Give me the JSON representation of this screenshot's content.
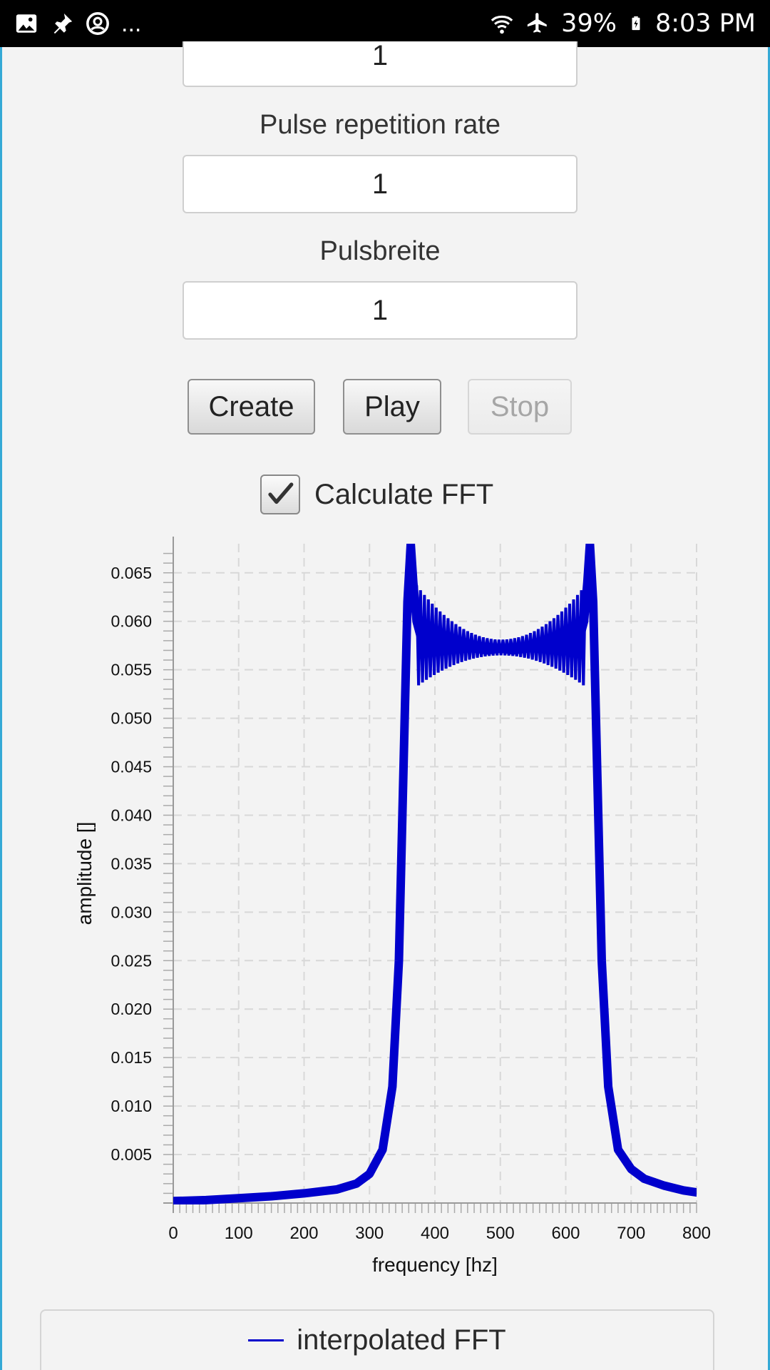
{
  "status_bar": {
    "icons_left": [
      "image-icon",
      "pin-icon",
      "account-circle-icon"
    ],
    "more": "...",
    "icons_right": [
      "wifi-icon",
      "airplane-icon",
      "battery-charging-icon"
    ],
    "battery": "39%",
    "time": "8:03 PM"
  },
  "form": {
    "top_field_value": "1",
    "prr_label": "Pulse repetition rate",
    "prr_value": "1",
    "pw_label": "Pulsbreite",
    "pw_value": "1"
  },
  "buttons": {
    "create": "Create",
    "play": "Play",
    "stop": "Stop"
  },
  "fft_checkbox": {
    "label": "Calculate FFT",
    "checked": true
  },
  "chart_data": {
    "type": "line",
    "xlabel": "frequency [hz]",
    "ylabel": "amplitude []",
    "xlim": [
      0,
      800
    ],
    "ylim": [
      0,
      0.068
    ],
    "x_ticks": [
      "0",
      "100",
      "200",
      "300",
      "400",
      "500",
      "600",
      "700",
      "800"
    ],
    "y_ticks": [
      "0.005",
      "0.010",
      "0.015",
      "0.020",
      "0.025",
      "0.030",
      "0.035",
      "0.040",
      "0.045",
      "0.050",
      "0.055",
      "0.060",
      "0.065"
    ],
    "grid": true,
    "legend_position": "bottom",
    "color": "#0000cc",
    "series": [
      {
        "name": "interpolated FFT",
        "x": [
          0,
          50,
          100,
          150,
          200,
          250,
          280,
          300,
          320,
          335,
          345,
          352,
          358,
          363,
          367,
          372,
          380,
          400,
          430,
          460,
          480,
          500,
          520,
          540,
          570,
          600,
          620,
          628,
          633,
          637,
          642,
          648,
          655,
          665,
          680,
          700,
          720,
          750,
          780,
          800
        ],
        "y": [
          0.0002,
          0.0003,
          0.0005,
          0.0007,
          0.001,
          0.0014,
          0.002,
          0.003,
          0.0055,
          0.012,
          0.025,
          0.045,
          0.062,
          0.068,
          0.064,
          0.06,
          0.058,
          0.058,
          0.0575,
          0.0572,
          0.057,
          0.0572,
          0.057,
          0.0572,
          0.0575,
          0.058,
          0.058,
          0.06,
          0.064,
          0.068,
          0.062,
          0.045,
          0.025,
          0.012,
          0.0055,
          0.0035,
          0.0025,
          0.0018,
          0.0013,
          0.0011
        ]
      }
    ]
  }
}
